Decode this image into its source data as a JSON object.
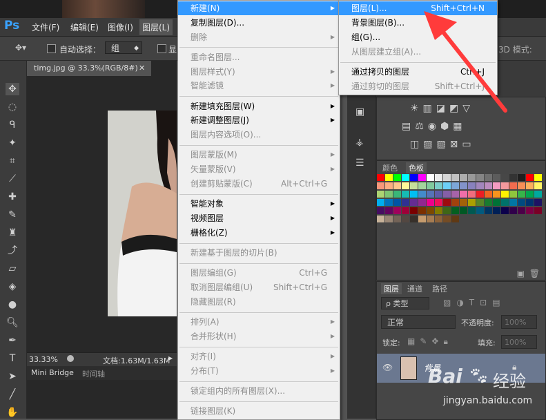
{
  "app": {
    "logo": "Ps",
    "window_controls": {
      "restore": "▭",
      "close": "✕"
    }
  },
  "menubar": {
    "file": "文件(F)",
    "edit": "编辑(E)",
    "image": "图像(I)",
    "layer": "图层(L)"
  },
  "options": {
    "auto_select_label": "自动选择：",
    "auto_select_value": "组",
    "show_partial": "显",
    "mode_3d": "3D 模式:"
  },
  "document": {
    "tab_title": "timg.jpg @ 33.3%(RGB/8#)",
    "tab_close": "✕",
    "zoom": "33.33%",
    "doc_info": "文档:1.63M/1.63M",
    "bottom_tabs": [
      "Mini Bridge",
      "时间轴"
    ]
  },
  "menu_layer": {
    "items": [
      {
        "label": "新建(N)",
        "shortcut": "",
        "submenu": true,
        "state": "highlight"
      },
      {
        "label": "复制图层(D)...",
        "shortcut": "",
        "submenu": false,
        "state": "normal"
      },
      {
        "label": "删除",
        "shortcut": "",
        "submenu": true,
        "state": "disabled"
      },
      {
        "sep": true
      },
      {
        "label": "重命名图层...",
        "shortcut": "",
        "submenu": false,
        "state": "disabled"
      },
      {
        "label": "图层样式(Y)",
        "shortcut": "",
        "submenu": true,
        "state": "disabled"
      },
      {
        "label": "智能滤镜",
        "shortcut": "",
        "submenu": true,
        "state": "disabled"
      },
      {
        "sep": true
      },
      {
        "label": "新建填充图层(W)",
        "shortcut": "",
        "submenu": true,
        "state": "normal"
      },
      {
        "label": "新建调整图层(J)",
        "shortcut": "",
        "submenu": true,
        "state": "normal"
      },
      {
        "label": "图层内容选项(O)...",
        "shortcut": "",
        "submenu": false,
        "state": "disabled"
      },
      {
        "sep": true
      },
      {
        "label": "图层蒙版(M)",
        "shortcut": "",
        "submenu": true,
        "state": "disabled"
      },
      {
        "label": "矢量蒙版(V)",
        "shortcut": "",
        "submenu": true,
        "state": "disabled"
      },
      {
        "label": "创建剪贴蒙版(C)",
        "shortcut": "Alt+Ctrl+G",
        "submenu": false,
        "state": "disabled"
      },
      {
        "sep": true
      },
      {
        "label": "智能对象",
        "shortcut": "",
        "submenu": true,
        "state": "normal"
      },
      {
        "label": "视频图层",
        "shortcut": "",
        "submenu": true,
        "state": "normal"
      },
      {
        "label": "栅格化(Z)",
        "shortcut": "",
        "submenu": true,
        "state": "normal"
      },
      {
        "sep": true
      },
      {
        "label": "新建基于图层的切片(B)",
        "shortcut": "",
        "submenu": false,
        "state": "disabled"
      },
      {
        "sep": true
      },
      {
        "label": "图层编组(G)",
        "shortcut": "Ctrl+G",
        "submenu": false,
        "state": "disabled"
      },
      {
        "label": "取消图层编组(U)",
        "shortcut": "Shift+Ctrl+G",
        "submenu": false,
        "state": "disabled"
      },
      {
        "label": "隐藏图层(R)",
        "shortcut": "",
        "submenu": false,
        "state": "disabled"
      },
      {
        "sep": true
      },
      {
        "label": "排列(A)",
        "shortcut": "",
        "submenu": true,
        "state": "disabled"
      },
      {
        "label": "合并形状(H)",
        "shortcut": "",
        "submenu": true,
        "state": "disabled"
      },
      {
        "sep": true
      },
      {
        "label": "对齐(I)",
        "shortcut": "",
        "submenu": true,
        "state": "disabled"
      },
      {
        "label": "分布(T)",
        "shortcut": "",
        "submenu": true,
        "state": "disabled"
      },
      {
        "sep": true
      },
      {
        "label": "锁定组内的所有图层(X)...",
        "shortcut": "",
        "submenu": false,
        "state": "disabled"
      },
      {
        "sep": true
      },
      {
        "label": "链接图层(K)",
        "shortcut": "",
        "submenu": false,
        "state": "disabled"
      }
    ]
  },
  "menu_new": {
    "items": [
      {
        "label": "图层(L)...",
        "shortcut": "Shift+Ctrl+N",
        "state": "highlight"
      },
      {
        "label": "背景图层(B)...",
        "shortcut": "",
        "state": "normal"
      },
      {
        "label": "组(G)...",
        "shortcut": "",
        "state": "normal"
      },
      {
        "label": "从图层建立组(A)...",
        "shortcut": "",
        "state": "disabled"
      },
      {
        "sep": true
      },
      {
        "label": "通过拷贝的图层",
        "shortcut": "Ctrl+J",
        "state": "normal"
      },
      {
        "label": "通过剪切的图层",
        "shortcut": "Shift+Ctrl+J",
        "state": "disabled"
      }
    ]
  },
  "swatches_panel": {
    "tabs": [
      "颜色",
      "色板"
    ]
  },
  "layers_panel": {
    "tabs": [
      "图层",
      "通道",
      "路径"
    ],
    "filter_label": "ρ 类型",
    "blend_mode": "正常",
    "opacity_label": "不透明度:",
    "opacity_value": "100%",
    "lock_label": "锁定:",
    "fill_label": "填充:",
    "fill_value": "100%",
    "layer_name": "背景"
  },
  "watermark": {
    "brand": "Bai",
    "brand2": "经验",
    "url": "jingyan.baidu.com"
  },
  "colors": {
    "highlight": "#3399ff",
    "arrow": "#ff3b3b",
    "ps_blue": "#3aa3ff"
  }
}
